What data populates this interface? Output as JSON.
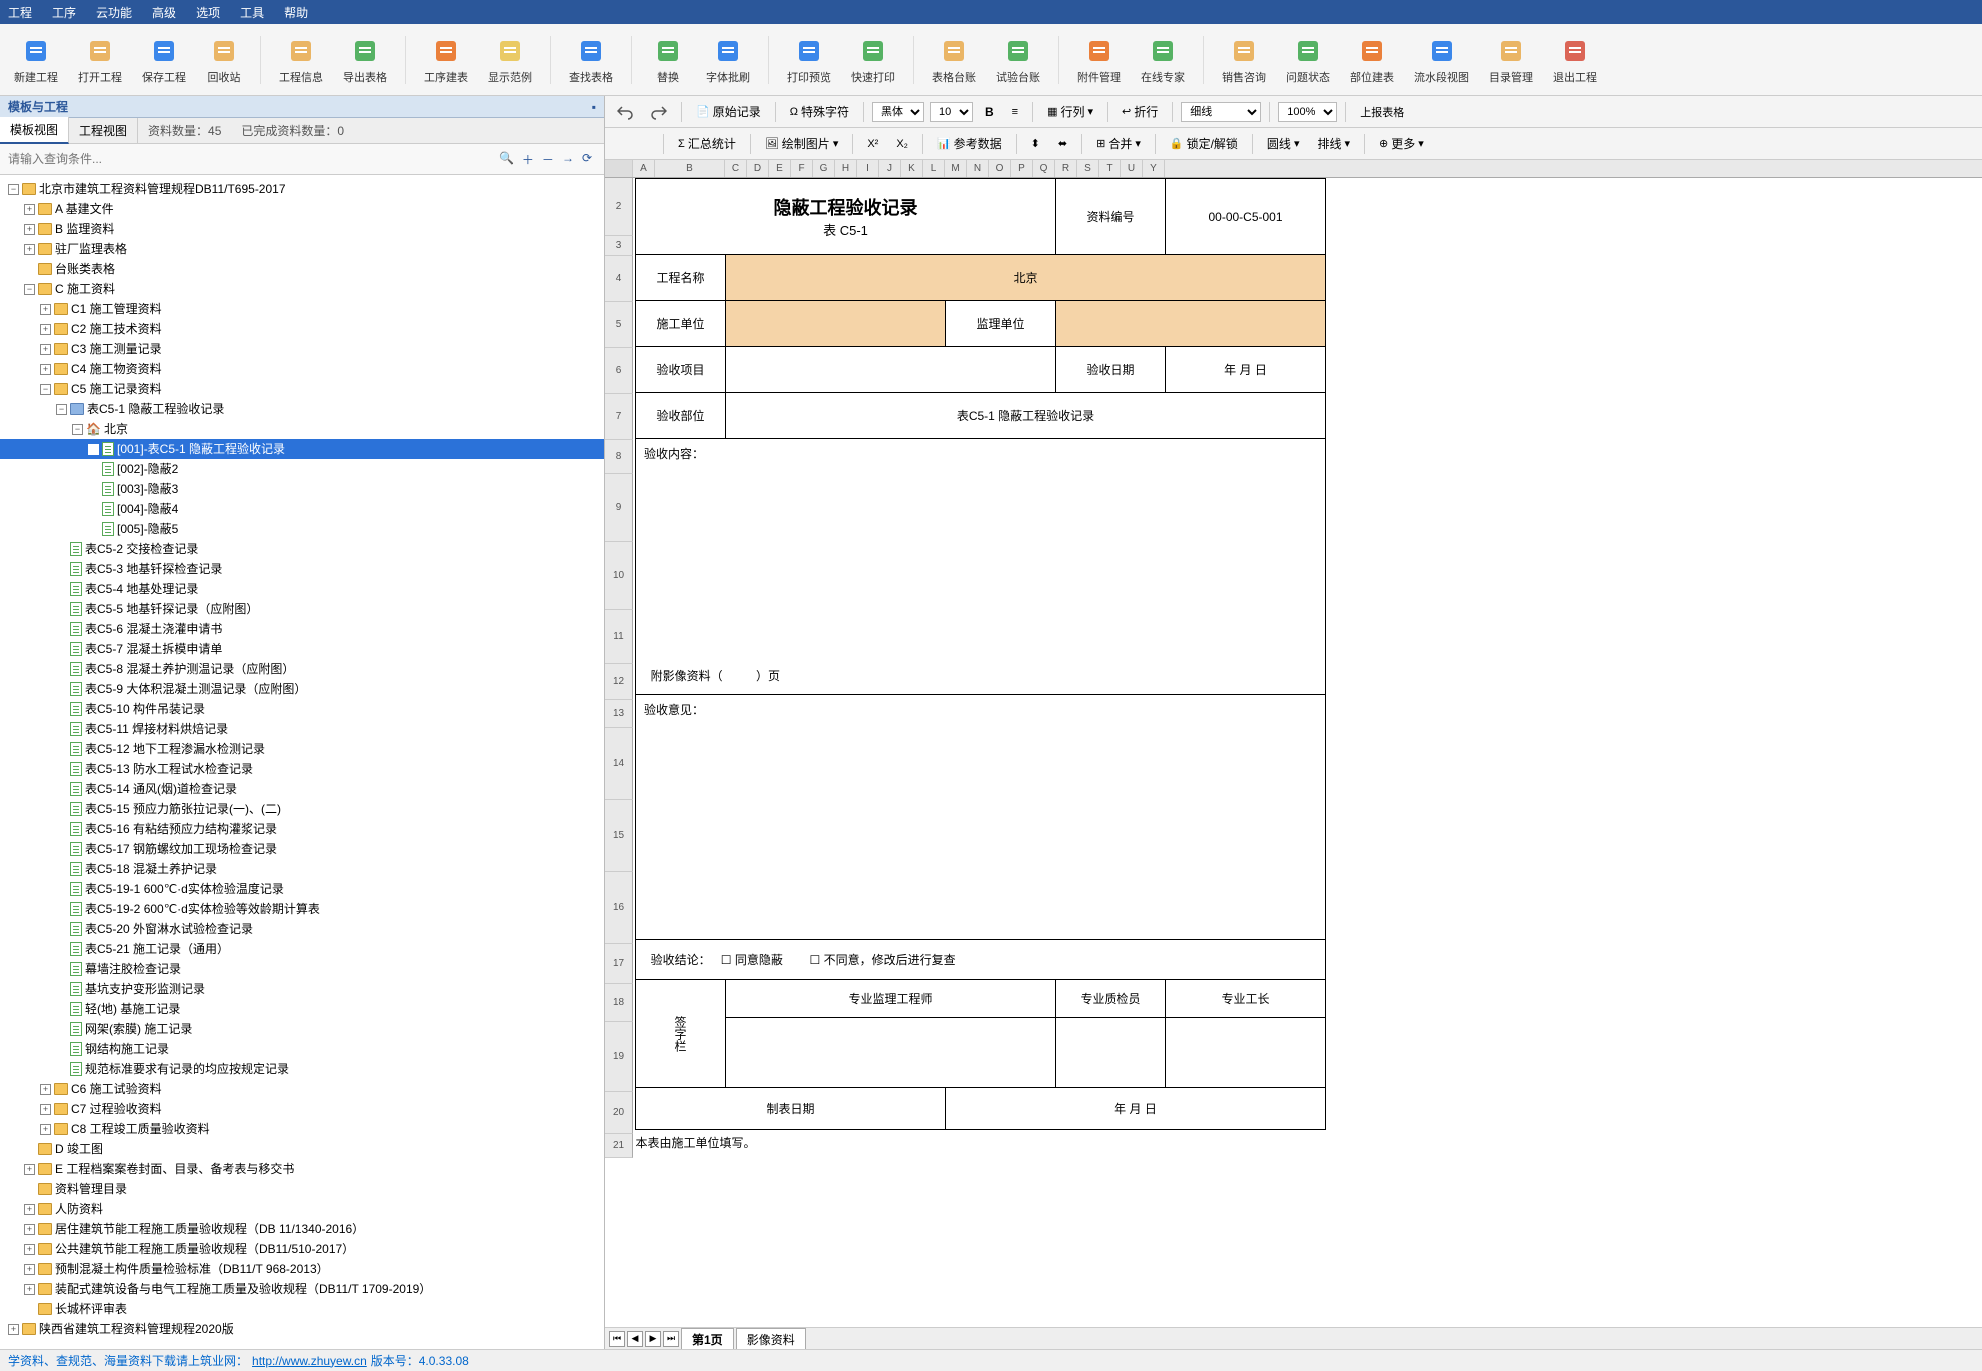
{
  "menu": [
    "工程",
    "工序",
    "云功能",
    "高级",
    "选项",
    "工具",
    "帮助"
  ],
  "ribbon": [
    {
      "label": "新建工程",
      "color": "#1a73e8"
    },
    {
      "label": "打开工程",
      "color": "#e8a94b"
    },
    {
      "label": "保存工程",
      "color": "#1a73e8"
    },
    {
      "label": "回收站",
      "color": "#e8a94b"
    },
    {
      "sep": true
    },
    {
      "label": "工程信息",
      "color": "#e8a94b"
    },
    {
      "label": "导出表格",
      "color": "#3aa64a"
    },
    {
      "sep": true
    },
    {
      "label": "工序建表",
      "color": "#e86b1a"
    },
    {
      "label": "显示范例",
      "color": "#e8c24b"
    },
    {
      "sep": true
    },
    {
      "label": "查找表格",
      "color": "#1a73e8"
    },
    {
      "sep": true
    },
    {
      "label": "替换",
      "color": "#3aa64a"
    },
    {
      "label": "字体批刷",
      "color": "#1a73e8"
    },
    {
      "sep": true
    },
    {
      "label": "打印预览",
      "color": "#1a73e8"
    },
    {
      "label": "快速打印",
      "color": "#3aa64a"
    },
    {
      "sep": true
    },
    {
      "label": "表格台账",
      "color": "#e8a94b"
    },
    {
      "label": "试验台账",
      "color": "#3aa64a"
    },
    {
      "sep": true
    },
    {
      "label": "附件管理",
      "color": "#e86b1a"
    },
    {
      "label": "在线专家",
      "color": "#3aa64a"
    },
    {
      "sep": true
    },
    {
      "label": "销售咨询",
      "color": "#e8a94b"
    },
    {
      "label": "问题状态",
      "color": "#3aa64a"
    },
    {
      "label": "部位建表",
      "color": "#e86b1a"
    },
    {
      "label": "流水段视图",
      "color": "#1a73e8"
    },
    {
      "label": "目录管理",
      "color": "#e8a94b"
    },
    {
      "label": "退出工程",
      "color": "#d64b3a"
    }
  ],
  "left": {
    "title": "模板与工程",
    "tabs": [
      "模板视图",
      "工程视图"
    ],
    "info1": "资料数量：45",
    "info2": "已完成资料数量：0",
    "search_placeholder": "请输入查询条件...",
    "tree_root": "北京市建筑工程资料管理规程DB11/T695-2017",
    "nodes": {
      "a": "A 基建文件",
      "b": "B 监理资料",
      "zc": "驻厂监理表格",
      "tz": "台账类表格",
      "c": "C 施工资料",
      "c1": "C1 施工管理资料",
      "c2": "C2 施工技术资料",
      "c3": "C3 施工测量记录",
      "c4": "C4 施工物资资料",
      "c5": "C5 施工记录资料",
      "c51": "表C5-1 隐蔽工程验收记录",
      "bj": "北京",
      "it1": "[001]-表C5-1 隐蔽工程验收记录",
      "it2": "[002]-隐蔽2",
      "it3": "[003]-隐蔽3",
      "it4": "[004]-隐蔽4",
      "it5": "[005]-隐蔽5",
      "c52": "表C5-2 交接检查记录",
      "c53": "表C5-3 地基钎探检查记录",
      "c54": "表C5-4 地基处理记录",
      "c55": "表C5-5 地基钎探记录（应附图）",
      "c56": "表C5-6 混凝土浇灌申请书",
      "c57": "表C5-7 混凝土拆模申请单",
      "c58": "表C5-8 混凝土养护测温记录（应附图）",
      "c59": "表C5-9 大体积混凝土测温记录（应附图）",
      "c510": "表C5-10 构件吊装记录",
      "c511": "表C5-11 焊接材料烘焙记录",
      "c512": "表C5-12 地下工程渗漏水检测记录",
      "c513": "表C5-13 防水工程试水检查记录",
      "c514": "表C5-14 通风(烟)道检查记录",
      "c515": "表C5-15 预应力筋张拉记录(一)、(二)",
      "c516": "表C5-16 有粘结预应力结构灌浆记录",
      "c517": "表C5-17 钢筋螺纹加工现场检查记录",
      "c518": "表C5-18 混凝土养护记录",
      "c519": "表C5-19-1 600℃·d实体检验温度记录",
      "c5192": "表C5-19-2 600℃·d实体检验等效龄期计算表",
      "c520": "表C5-20 外窗淋水试验检查记录",
      "c521": "表C5-21 施工记录（通用）",
      "mjj": "幕墙注胶检查记录",
      "jkz": "基坑支护变形监测记录",
      "qd": "轻(地) 基施工记录",
      "wj": "网架(索膜) 施工记录",
      "gj": "钢结构施工记录",
      "gf": "规范标准要求有记录的均应按规定记录",
      "c6": "C6 施工试验资料",
      "c7": "C7 过程验收资料",
      "c8": "C8 工程竣工质量验收资料",
      "d": "D 竣工图",
      "e": "E 工程档案案卷封面、目录、备考表与移交书",
      "zl": "资料管理目录",
      "rf": "人防资料",
      "jz": "居住建筑节能工程施工质量验收规程（DB 11/1340-2016）",
      "gg": "公共建筑节能工程施工质量验收规程（DB11/510-2017）",
      "yz": "预制混凝土构件质量检验标准（DB11/T 968-2013）",
      "zp": "装配式建筑设备与电气工程施工质量及验收规程（DB11/T 1709-2019）",
      "cc": "长城杯评审表",
      "sx": "陕西省建筑工程资料管理规程2020版"
    }
  },
  "sheet_toolbar": {
    "raw": "原始记录",
    "spec": "特殊字符",
    "sum": "汇总统计",
    "draw": "绘制图片",
    "ref": "参考数据",
    "row": "行列",
    "merge": "合并",
    "wrap": "折行",
    "lock": "锁定/解锁",
    "line": "圆线",
    "sort": "排线",
    "more": "更多",
    "font": "黑体",
    "size": "10",
    "border": "细线",
    "zoom": "100%",
    "upload": "上报表格"
  },
  "cols": [
    "A",
    "B",
    "C",
    "D",
    "E",
    "F",
    "G",
    "H",
    "I",
    "J",
    "K",
    "L",
    "M",
    "N",
    "O",
    "P",
    "Q",
    "R",
    "S",
    "T",
    "U",
    "Y"
  ],
  "form": {
    "title": "隐蔽工程验收记录",
    "sub": "表  C5-1",
    "num_lbl": "资料编号",
    "num": "00-00-C5-001",
    "name_lbl": "工程名称",
    "name": "北京",
    "unit_lbl": "施工单位",
    "sup_lbl": "监理单位",
    "item_lbl": "验收项目",
    "date_lbl": "验收日期",
    "date": "年   月   日",
    "part_lbl": "验收部位",
    "part": "表C5-1 隐蔽工程验收记录",
    "content_lbl": "验收内容：",
    "att": "附影像资料（",
    "att2": "）页",
    "op_lbl": "验收意见：",
    "res_lbl": "验收结论：",
    "chk1": "同意隐蔽",
    "chk2": "不同意，修改后进行复查",
    "sign": "签字栏",
    "s1": "专业监理工程师",
    "s2": "专业质检员",
    "s3": "专业工长",
    "mdate_lbl": "制表日期",
    "mdate": "年   月   日",
    "note": "本表由施工单位填写。"
  },
  "sheet_tabs": {
    "p1": "第1页",
    "p2": "影像资料"
  },
  "status": {
    "text": "学资料、查规范、海量资料下载请上筑业网：",
    "url": "http://www.zhuyew.cn",
    "ver": "  版本号：4.0.33.08"
  }
}
